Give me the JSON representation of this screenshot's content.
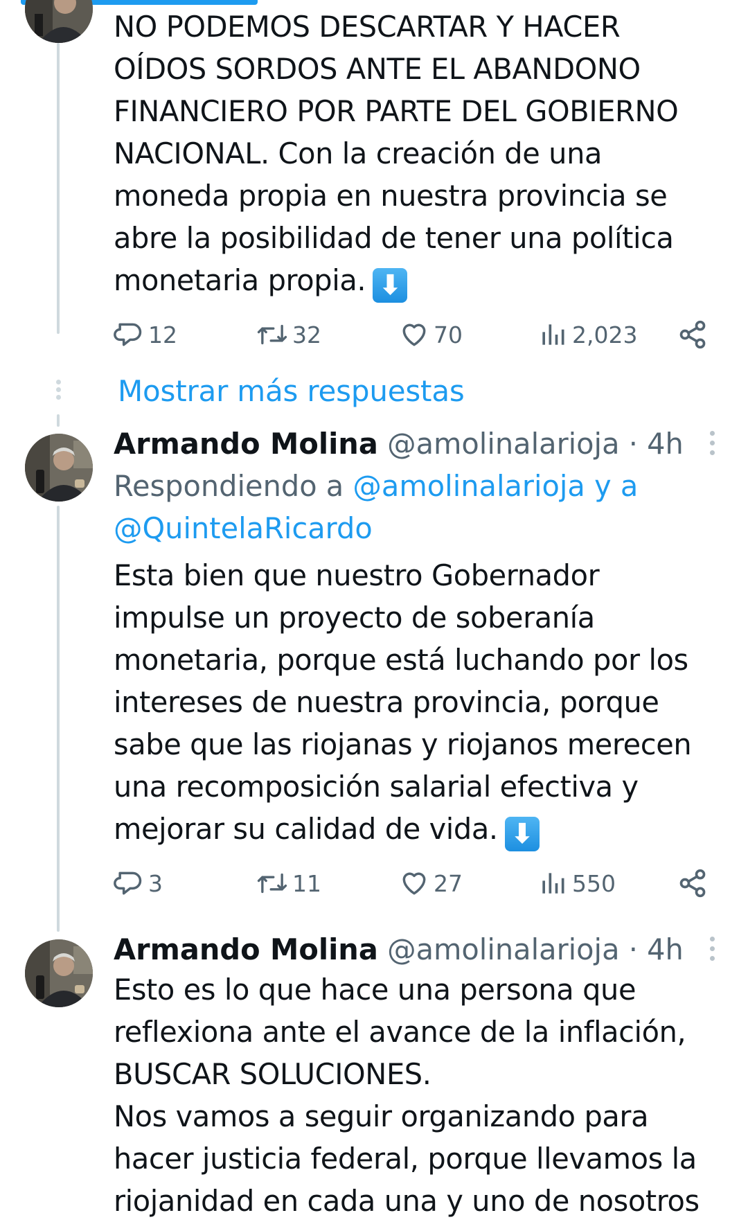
{
  "tweets": [
    {
      "text": "NO PODEMOS DESCARTAR Y HACER\nOÍDOS SORDOS ANTE EL ABANDONO\nFINANCIERO POR PARTE DEL GOBIERNO\nNACIONAL. Con la creación de una\nmoneda propia en nuestra provincia se\nabre la posibilidad de tener una política\nmonetaria propia.",
      "emoji": "⬇",
      "replies": "12",
      "retweets": "32",
      "likes": "70",
      "views": "2,023"
    },
    {
      "author": "Armando Molina",
      "handle": "@amolinalarioja",
      "time": "· 4h",
      "replying_prefix": "Respondiendo a ",
      "replying_mention_1": "@amolinalarioja",
      "replying_and": " y a",
      "replying_mention_2": "@QuintelaRicardo",
      "text": "Esta bien que nuestro Gobernador\nimpulse un proyecto de soberanía\nmonetaria, porque está luchando por los\nintereses de nuestra provincia, porque\nsabe que las riojanas y riojanos merecen\nuna recomposición salarial efectiva y\nmejorar su calidad de vida.",
      "emoji": "⬇",
      "replies": "3",
      "retweets": "11",
      "likes": "27",
      "views": "550"
    },
    {
      "author": "Armando Molina",
      "handle": "@amolinalarioja",
      "time": "· 4h",
      "text": "Esto es lo que hace una persona que\nreflexiona ante el avance de la inflación,\nBUSCAR SOLUCIONES.\nNos vamos a seguir organizando para\nhacer justicia federal, porque llevamos la\nriojanidad en cada una y uno de nosotros"
    }
  ],
  "show_more_label": "Mostrar más respuestas",
  "colors": {
    "accent": "#1d9bf0",
    "text": "#0f1419",
    "muted": "#536471",
    "thread_line": "#cfd9de"
  },
  "icons": [
    "reply-icon",
    "retweet-icon",
    "like-icon",
    "views-icon",
    "share-icon",
    "more-icon",
    "down-arrow-emoji"
  ]
}
